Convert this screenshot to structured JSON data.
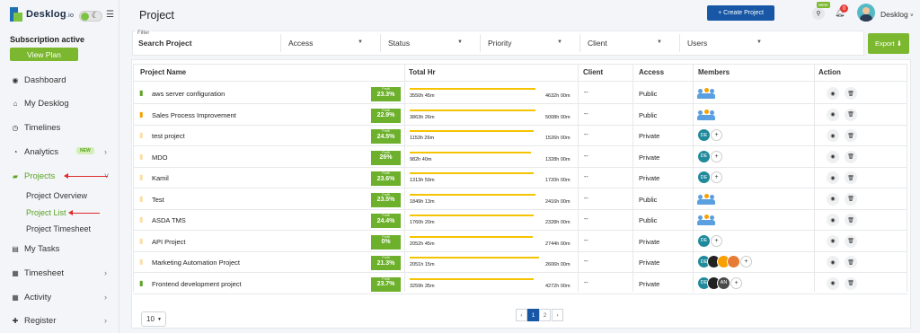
{
  "app": {
    "logo_name": "Desk",
    "logo_name_2": "log",
    "logo_suffix": ".io",
    "menu_icon": "hamburger-icon"
  },
  "subscription": {
    "status": "Subscription active",
    "button": "View Plan"
  },
  "sidebar": {
    "items": [
      {
        "label": "Dashboard",
        "icon": "dashboard-icon"
      },
      {
        "label": "My Desklog",
        "icon": "home-icon"
      },
      {
        "label": "Timelines",
        "icon": "clock-icon"
      },
      {
        "label": "Analytics",
        "icon": "pie-icon",
        "badge": "NEW"
      },
      {
        "label": "Projects",
        "icon": "folder-icon"
      },
      {
        "label": "My Tasks",
        "icon": "tasks-icon"
      },
      {
        "label": "Timesheet",
        "icon": "calendar-icon"
      },
      {
        "label": "Activity",
        "icon": "grid-icon"
      },
      {
        "label": "Register",
        "icon": "plus-icon"
      }
    ],
    "projects_sub": [
      "Project Overview",
      "Project List",
      "Project Timesheet"
    ]
  },
  "header": {
    "title": "Project",
    "create_button": "+ Create Project",
    "new_tag": "NEW",
    "bell_count": "0",
    "user_name": "Desklog"
  },
  "filters": {
    "label": "Filter",
    "search_placeholder": "Search Project",
    "fields": [
      "Access",
      "Status",
      "Priority",
      "Client",
      "Users"
    ],
    "export": "Export"
  },
  "table": {
    "headers": [
      "Project Name",
      "Total Hr",
      "Client",
      "Access",
      "Members",
      "Action"
    ],
    "profit_label": "Profit",
    "rows": [
      {
        "name": "aws server configuration",
        "pin": "green",
        "profit": "23.3%",
        "hrs": "3550h 45m",
        "total": "4632h 00m",
        "client": "--",
        "access": "Public",
        "members": "team",
        "bar": 0.77
      },
      {
        "name": "Sales Process Improvement",
        "pin": "orange",
        "profit": "22.9%",
        "hrs": "3863h 26m",
        "total": "5008h 00m",
        "client": "--",
        "access": "Public",
        "members": "team",
        "bar": 0.77
      },
      {
        "name": "test project",
        "pin": "faint",
        "profit": "24.5%",
        "hrs": "1153h 26m",
        "total": "1526h 00m",
        "client": "--",
        "access": "Private",
        "members": "DE",
        "bar": 0.76
      },
      {
        "name": "MDO",
        "pin": "faint",
        "profit": "26%",
        "hrs": "982h 40m",
        "total": "1328h 00m",
        "client": "--",
        "access": "Private",
        "members": "DE",
        "bar": 0.74
      },
      {
        "name": "Kamil",
        "pin": "faint",
        "profit": "23.6%",
        "hrs": "1313h 59m",
        "total": "1720h 00m",
        "client": "--",
        "access": "Private",
        "members": "DE",
        "bar": 0.76
      },
      {
        "name": "Test",
        "pin": "faint",
        "profit": "23.5%",
        "hrs": "1849h 13m",
        "total": "2416h 00m",
        "client": "--",
        "access": "Public",
        "members": "team",
        "bar": 0.77
      },
      {
        "name": "ASDA TMS",
        "pin": "faint",
        "profit": "24.4%",
        "hrs": "1760h 20m",
        "total": "2328h 00m",
        "client": "--",
        "access": "Public",
        "members": "team",
        "bar": 0.76
      },
      {
        "name": "API Project",
        "pin": "faint",
        "profit": "0%",
        "hrs": "2052h 45m",
        "total": "2744h 00m",
        "client": "--",
        "access": "Private",
        "members": "DE",
        "bar": 0.75
      },
      {
        "name": "Marketing Automation Project",
        "pin": "faint",
        "profit": "21.3%",
        "hrs": "2051h 15m",
        "total": "2606h 00m",
        "client": "--",
        "access": "Private",
        "members": "DE+3",
        "bar": 0.79
      },
      {
        "name": "Frontend development project",
        "pin": "green",
        "profit": "23.7%",
        "hrs": "3259h 35m",
        "total": "4272h 00m",
        "client": "--",
        "access": "Private",
        "members": "DE+AN",
        "bar": 0.76
      }
    ]
  },
  "pagination": {
    "page_size": "10",
    "pages": [
      "‹",
      "1",
      "2",
      "›"
    ],
    "active": "1"
  },
  "colors": {
    "accent": "#7cb82f",
    "primary": "#1757a6",
    "bar": "#f5c400",
    "arrow": "#e02b2b"
  }
}
